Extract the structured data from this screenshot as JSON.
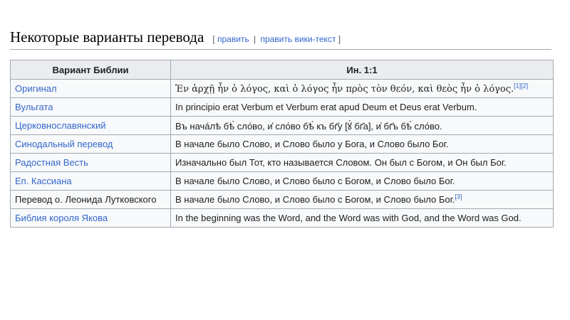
{
  "section": {
    "title": "Некоторые варианты перевода",
    "edit_open": "[",
    "edit_label": "править",
    "edit_separator": "|",
    "edit_source_label": "править вики-текст",
    "edit_close": "]"
  },
  "table": {
    "headers": [
      "Вариант Библии",
      "Ин. 1:1"
    ],
    "rows": [
      {
        "version": "Оригинал",
        "text": "Ἐν ἀρχῇ ἦν ὁ λόγος, καὶ ὁ λόγος ἦν πρὸς τὸν θεόν, καὶ θεὸς ἦν ὁ λόγος.",
        "refs": [
          "[1]",
          "[2]"
        ]
      },
      {
        "version": "Вульгата",
        "text": "In principio erat Verbum et Verbum erat apud Deum et Deus erat Verbum.",
        "refs": []
      },
      {
        "version": "Церковнославянский",
        "text": "Въ начáлѣ бѣ̀ сло́во, и҆ сло́во бѣ̀ къ бг҃у [ꙋ҆ бг҃а], и҆ бг҃ъ бѣ̀ сло́во.",
        "refs": []
      },
      {
        "version": "Синодальный перевод",
        "text": "В начале было Слово, и Слово было у Бога, и Слово было Бог.",
        "refs": []
      },
      {
        "version": "Радостная Весть",
        "text": "Изначально был Тот, кто называется Словом. Он был с Богом, и Он был Бог.",
        "refs": []
      },
      {
        "version": "Еп. Кассиана",
        "text": "В начале было Слово, и Слово было с Богом, и Слово было Бог.",
        "refs": []
      },
      {
        "version": "Перевод о. Леонида Лутковского",
        "text": "В начале было Слово, и Слово было с Богом, и Слово было Бог.",
        "refs": [
          "[3]"
        ]
      },
      {
        "version": "Библия короля Якова",
        "text": "In the beginning was the Word, and the Word was with God, and the Word was God.",
        "refs": []
      }
    ]
  }
}
